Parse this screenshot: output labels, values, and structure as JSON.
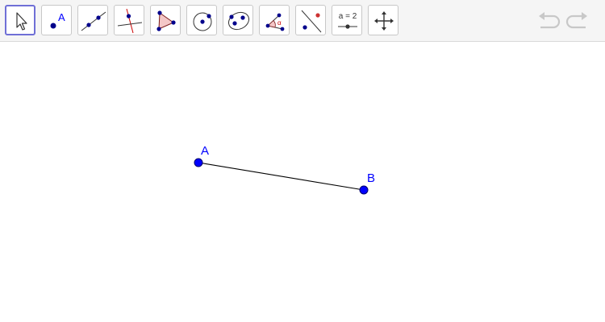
{
  "toolbar": {
    "tools": [
      {
        "name": "move",
        "icon": "arrow-cursor-icon",
        "selected": true
      },
      {
        "name": "point",
        "icon": "point-icon",
        "label": "A"
      },
      {
        "name": "line",
        "icon": "line-through-points-icon"
      },
      {
        "name": "perpendicular-line",
        "icon": "perpendicular-line-icon"
      },
      {
        "name": "polygon",
        "icon": "polygon-icon"
      },
      {
        "name": "circle",
        "icon": "circle-center-point-icon"
      },
      {
        "name": "ellipse",
        "icon": "ellipse-icon"
      },
      {
        "name": "angle",
        "icon": "angle-icon",
        "label": "α"
      },
      {
        "name": "reflect",
        "icon": "reflect-about-line-icon"
      },
      {
        "name": "slider",
        "icon": "slider-icon",
        "label": "a = 2"
      },
      {
        "name": "move-graphics-view",
        "icon": "move-graphics-view-icon"
      }
    ],
    "undo_icon": "undo-icon",
    "redo_icon": "redo-icon"
  },
  "construction": {
    "points": [
      {
        "name": "A",
        "label": "A",
        "color": "#0000ff"
      },
      {
        "name": "B",
        "label": "B",
        "color": "#0000ff"
      }
    ],
    "segment": {
      "from": "A",
      "to": "B",
      "color": "#000000"
    }
  },
  "colors": {
    "point": "#0000ff",
    "selection_border": "#6f6fd6",
    "polygon_fill": "#f4c7c7",
    "accent_red": "#cc0000",
    "disabled_icon": "#c8c8c8"
  }
}
